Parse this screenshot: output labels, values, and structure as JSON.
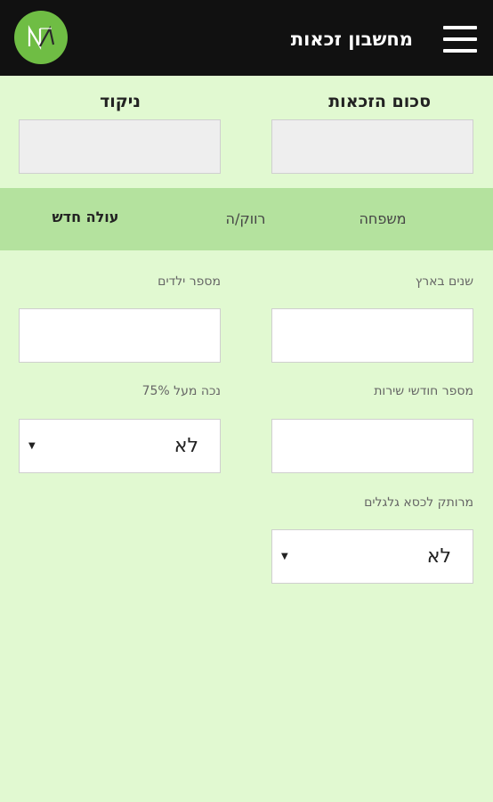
{
  "header": {
    "title": "מחשבון זכאות",
    "menu_icon": "hamburger-menu-icon",
    "logo_icon": "app-logo"
  },
  "results": {
    "total_label": "סכום הזכאות",
    "score_label": "ניקוד",
    "total_value": "",
    "score_value": ""
  },
  "tabs": [
    {
      "label": "משפחה",
      "active": false
    },
    {
      "label": "רווק/ה",
      "active": false
    },
    {
      "label": "עולה חדש",
      "active": true
    }
  ],
  "form": {
    "years_label": "שנים בארץ",
    "years_value": "",
    "children_label": "מספר ילדים",
    "children_value": "",
    "service_label": "מספר חודשי שירות",
    "service_value": "",
    "disability_label": "נכה מעל 75%",
    "disability_value": "לא",
    "wheelchair_label": "מרותק לכסא גלגלים",
    "wheelchair_value": "לא"
  },
  "colors": {
    "background": "#e1f9d1",
    "topbar": "#111111",
    "tab_bar": "#b4e29e",
    "logo": "#6fbd44"
  }
}
